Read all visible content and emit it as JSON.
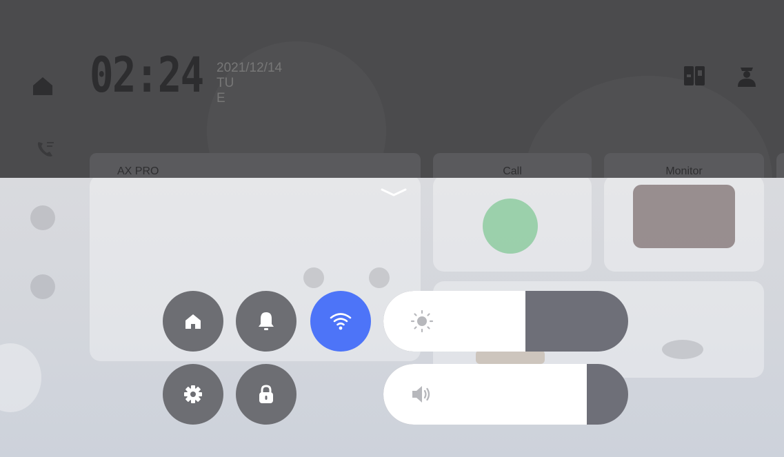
{
  "status": {
    "time": "02:24",
    "date_lines": [
      "2021/12/14",
      "TU",
      "E"
    ]
  },
  "cards": [
    {
      "label": "AX PRO"
    },
    {
      "label": "Call"
    },
    {
      "label": "Monitor"
    }
  ],
  "controls": {
    "buttons": [
      {
        "name": "home",
        "icon": "home-icon",
        "active": false
      },
      {
        "name": "alarm",
        "icon": "bell-icon",
        "active": false
      },
      {
        "name": "wifi",
        "icon": "wifi-icon",
        "active": true
      },
      {
        "name": "settings",
        "icon": "gear-icon",
        "active": false
      },
      {
        "name": "lock",
        "icon": "lock-icon",
        "active": false
      }
    ],
    "sliders": [
      {
        "name": "brightness",
        "icon": "sun-icon",
        "level": 0.58
      },
      {
        "name": "volume",
        "icon": "speaker-icon",
        "level": 0.83
      }
    ]
  },
  "colors": {
    "active": "#4d74f8",
    "button": "#6d6e73",
    "slider_track": "#6e6f78",
    "slider_fill": "#ffffff"
  }
}
